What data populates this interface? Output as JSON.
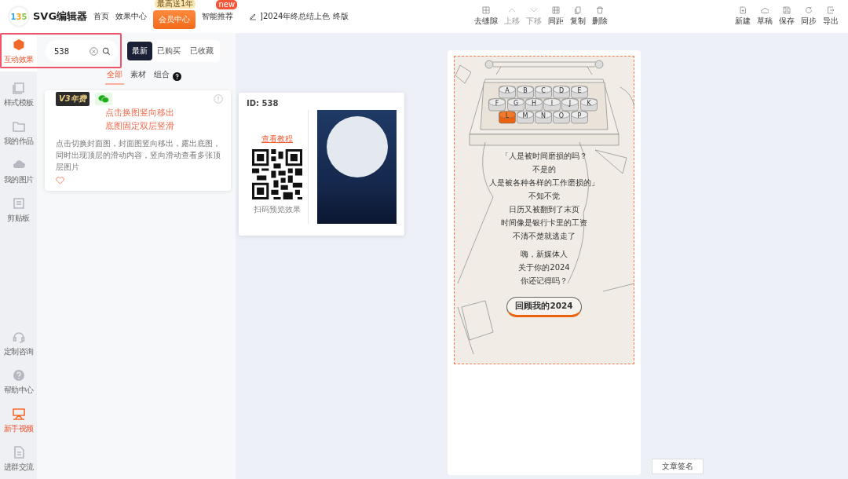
{
  "header": {
    "logo_mark": "135",
    "app_name": "SVG编辑器",
    "nav": [
      {
        "label": "首页",
        "kind": "link"
      },
      {
        "label": "效果中心",
        "kind": "link"
      },
      {
        "label": "会员中心",
        "kind": "primary",
        "badge": "最高送1年"
      },
      {
        "label": "智能推荐",
        "kind": "link",
        "badge": "new"
      }
    ],
    "document_title": "]2024年终总结上色 终版",
    "edit_actions": [
      {
        "label": "去缝隙",
        "kind": "gap",
        "disabled": false
      },
      {
        "label": "上移",
        "kind": "up",
        "disabled": true
      },
      {
        "label": "下移",
        "kind": "down",
        "disabled": true
      },
      {
        "label": "间距",
        "kind": "spacing",
        "disabled": false
      },
      {
        "label": "复制",
        "kind": "copy",
        "disabled": false
      },
      {
        "label": "删除",
        "kind": "delete",
        "disabled": false
      }
    ],
    "file_actions": [
      {
        "label": "新建",
        "kind": "new",
        "disabled": false
      },
      {
        "label": "草稿",
        "kind": "draft",
        "disabled": false
      },
      {
        "label": "保存",
        "kind": "save",
        "disabled": false
      },
      {
        "label": "同步",
        "kind": "sync",
        "disabled": false
      },
      {
        "label": "导出",
        "kind": "export",
        "disabled": false
      }
    ]
  },
  "sidebar": {
    "items": [
      {
        "label": "互动效果",
        "kind": "effects",
        "selected": true
      },
      {
        "label": "样式模板",
        "kind": "templates",
        "selected": false
      },
      {
        "label": "我的作品",
        "kind": "works",
        "selected": false
      },
      {
        "label": "我的图片",
        "kind": "images",
        "selected": false
      },
      {
        "label": "剪贴板",
        "kind": "clipboard",
        "selected": false
      }
    ],
    "bottom_items": [
      {
        "label": "定制咨询",
        "kind": "consult",
        "selected": false
      },
      {
        "label": "帮助中心",
        "kind": "help",
        "selected": false
      },
      {
        "label": "新手视频",
        "kind": "video",
        "selected": true
      },
      {
        "label": "进群交流",
        "kind": "group",
        "selected": false
      }
    ]
  },
  "panel": {
    "search": {
      "value": "538"
    },
    "filters": [
      {
        "label": "最新",
        "selected": true
      },
      {
        "label": "已购买",
        "selected": false
      },
      {
        "label": "已收藏",
        "selected": false
      }
    ],
    "categories": [
      {
        "label": "全部",
        "selected": true,
        "help": false
      },
      {
        "label": "素材",
        "selected": false,
        "help": false
      },
      {
        "label": "组合",
        "selected": false,
        "help": true
      }
    ],
    "card": {
      "badge": "V3年费",
      "title_lines": [
        "点击换图竖向移出",
        "底图固定双层竖滑"
      ],
      "description": "点击切换封面图，封面图竖向移出，露出底图，同时出现顶层的滑动内容，竖向滑动查看多张顶层图片",
      "favorited": false
    }
  },
  "preview": {
    "id_label": "ID: 538",
    "tutorial_link": "查看教程",
    "qr_caption": "扫码预览效果"
  },
  "canvas": {
    "key_rows": [
      {
        "keys": [
          {
            "label": "A",
            "selected": false
          },
          {
            "label": "B",
            "selected": false
          },
          {
            "label": "C",
            "selected": false
          },
          {
            "label": "D",
            "selected": false
          },
          {
            "label": "E",
            "selected": false
          }
        ]
      },
      {
        "keys": [
          {
            "label": "F",
            "selected": false
          },
          {
            "label": "G",
            "selected": false
          },
          {
            "label": "H",
            "selected": false
          },
          {
            "label": "I",
            "selected": false
          },
          {
            "label": "J",
            "selected": false
          },
          {
            "label": "K",
            "selected": false
          }
        ]
      },
      {
        "keys": [
          {
            "label": "L",
            "selected": true
          },
          {
            "label": "M",
            "selected": false
          },
          {
            "label": "N",
            "selected": false
          },
          {
            "label": "O",
            "selected": false
          },
          {
            "label": "P",
            "selected": false
          }
        ]
      }
    ],
    "paragraphs": [
      [
        "「人是被时间磨损的吗？",
        "不是的",
        "人是被各种各样的工作磨损的」",
        "不知不觉",
        "日历又被翻到了末页",
        "时间像是银行卡里的工资",
        "不清不楚就逃走了"
      ],
      [
        "嗨，新媒体人",
        "关于你的2024",
        "你还记得吗？"
      ]
    ],
    "action_button": "回顾我的2024",
    "signature_button": "文章签名"
  }
}
